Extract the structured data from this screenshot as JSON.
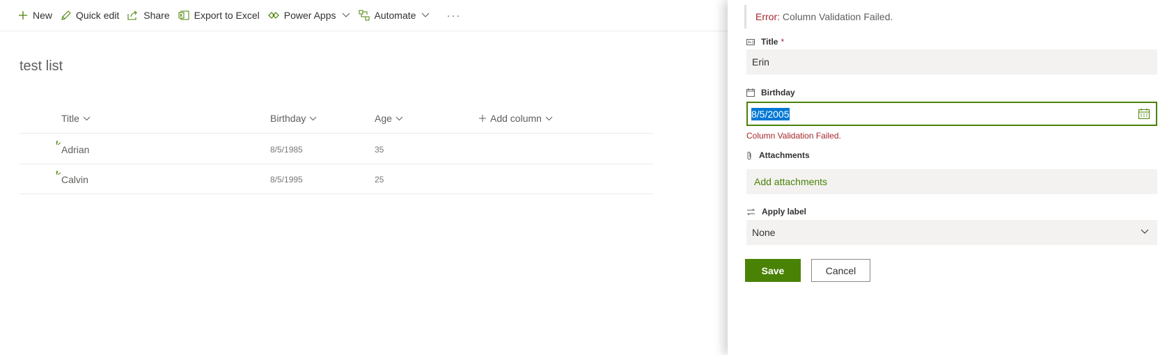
{
  "commandbar": {
    "new_label": "New",
    "quick_edit_label": "Quick edit",
    "share_label": "Share",
    "export_label": "Export to Excel",
    "powerapps_label": "Power Apps",
    "automate_label": "Automate",
    "more_label": "···"
  },
  "list": {
    "title": "test list",
    "columns": {
      "title": "Title",
      "birthday": "Birthday",
      "age": "Age",
      "add_column": "Add column"
    },
    "rows": [
      {
        "title": "Adrian",
        "birthday": "8/5/1985",
        "age": "35"
      },
      {
        "title": "Calvin",
        "birthday": "8/5/1995",
        "age": "25"
      }
    ]
  },
  "panel": {
    "error_label": "Error:",
    "error_message": " Column Validation Failed.",
    "title_label": "Title",
    "required_mark": "*",
    "title_value": "Erin",
    "birthday_label": "Birthday",
    "birthday_value": "8/5/2005",
    "validation_message": "Column Validation Failed.",
    "attachments_label": "Attachments",
    "add_attachments_label": "Add attachments",
    "apply_label_label": "Apply label",
    "apply_label_value": "None",
    "save_label": "Save",
    "cancel_label": "Cancel"
  },
  "colors": {
    "accent": "#498205",
    "error": "#a4262c",
    "selection": "#0078d4"
  }
}
